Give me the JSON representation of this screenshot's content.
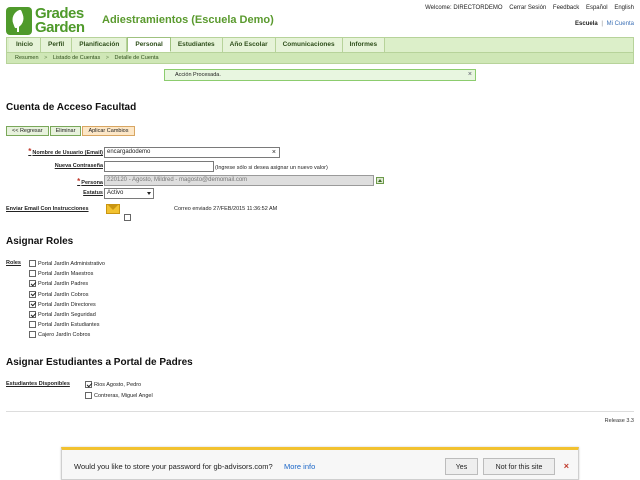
{
  "brand": {
    "line1": "Grades",
    "line2": "Garden"
  },
  "app_title": "Adiestramientos (Escuela Demo)",
  "topbar": {
    "welcome": "Welcome: DIRECTORDEMO",
    "logout": "Cerrar Sesión",
    "feedback": "Feedback",
    "lang_es": "Español",
    "lang_en": "English"
  },
  "school_links": {
    "current": "Escuela",
    "separator": "|",
    "mine": "Mi Cuenta"
  },
  "nav": {
    "tabs": [
      "Inicio",
      "Perfil",
      "Planificación",
      "Personal",
      "Estudiantes",
      "Año Escolar",
      "Comunicaciones",
      "Informes"
    ],
    "active": "Personal"
  },
  "breadcrumb": {
    "items": [
      "Resumen",
      "Listado de Cuentas",
      "Detalle de Cuenta"
    ],
    "separator": ">"
  },
  "notice": {
    "text": "Acción Procesada.",
    "close": "×"
  },
  "section_account": {
    "title": "Cuenta de Acceso Facultad",
    "buttons": {
      "back": "<< Regresar",
      "delete": "Eliminar",
      "apply": "Aplicar Cambios"
    },
    "username": {
      "label": "Nombre de Usuario (Email)",
      "value": "encargadodemo",
      "clear": "×"
    },
    "password": {
      "label": "Nueva Contraseña",
      "value": "",
      "hint": "(Ingrese sólo si desea asignar un nuevo valor)"
    },
    "person": {
      "label": "Persona",
      "value": "220120 - Agosto, Mildred - magosto@demomail.com"
    },
    "status": {
      "label": "Estatus",
      "value": "Activo"
    },
    "email_instructions": {
      "label": "Enviar Email Con Instrucciones",
      "sent": "Correo enviado 27/FEB/2015 11:36:52 AM"
    }
  },
  "section_roles": {
    "title": "Asignar Roles",
    "label": "Roles",
    "items": [
      {
        "label": "Portal Jardín Administrativo",
        "checked": false
      },
      {
        "label": "Portal Jardín Maestros",
        "checked": false
      },
      {
        "label": "Portal Jardín Padres",
        "checked": true
      },
      {
        "label": "Portal Jardín Cobros",
        "checked": true
      },
      {
        "label": "Portal Jardín Directores",
        "checked": true
      },
      {
        "label": "Portal Jardín Seguridad",
        "checked": true
      },
      {
        "label": "Portal Jardín Estudiantes",
        "checked": false
      },
      {
        "label": "Cajero Jardín Cobros",
        "checked": false
      }
    ]
  },
  "section_students": {
    "title": "Asignar Estudiantes a Portal de Padres",
    "label": "Estudiantes Disponibles",
    "items": [
      {
        "label": "Rios Agosto, Pedro",
        "checked": true
      },
      {
        "label": "Contreras, Miguel Angel",
        "checked": false
      }
    ]
  },
  "release": "Release 3.3",
  "password_bar": {
    "question": "Would you like to store your password for gb-advisors.com?",
    "more": "More info",
    "yes": "Yes",
    "no": "Not for this site",
    "close": "×"
  },
  "colors": {
    "accent": "#5a9a2e",
    "nav_bg": "#dcefc9",
    "notice_border": "#8ccc6e",
    "bar_border": "#f2c230"
  }
}
